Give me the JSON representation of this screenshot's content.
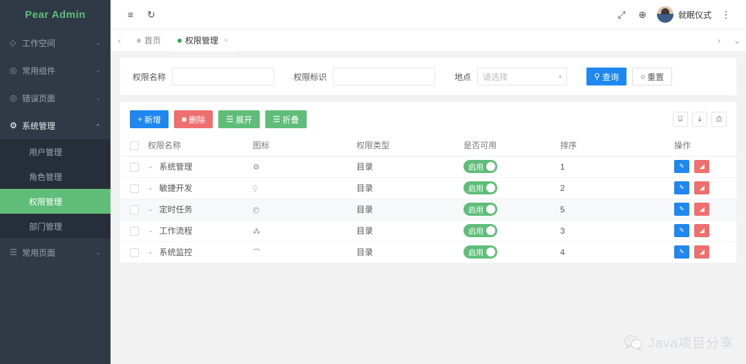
{
  "sidebar": {
    "logo": "Pear Admin",
    "items": [
      {
        "label": "工作空间",
        "icon": "compass-icon",
        "chevron": "⌄",
        "open": false
      },
      {
        "label": "常用组件",
        "icon": "cube-icon",
        "chevron": "⌄",
        "open": false
      },
      {
        "label": "错误页面",
        "icon": "shield-icon",
        "chevron": "⌄",
        "open": false
      },
      {
        "label": "系统管理",
        "icon": "gear-icon",
        "chevron": "⌄",
        "open": true
      },
      {
        "label": "常用页面",
        "icon": "layers-icon",
        "chevron": "⌄",
        "open": false
      }
    ],
    "subitems": [
      {
        "label": "用户管理",
        "active": false
      },
      {
        "label": "角色管理",
        "active": false
      },
      {
        "label": "权限管理",
        "active": true
      },
      {
        "label": "部门管理",
        "active": false
      }
    ],
    "active_color": "#5fbd79",
    "bg_color": "#2f3a46"
  },
  "topbar": {
    "menu_icon": "≡",
    "refresh_icon": "↻",
    "fullscreen_icon": "⤢",
    "language_icon": "⊕",
    "username": "就眠仪式",
    "more_icon": "⋮"
  },
  "tabbar": {
    "prev_icon": "‹",
    "next_icon": "›",
    "dropdown_icon": "⌄",
    "tabs": [
      {
        "label": "首页",
        "active": false,
        "closable": false
      },
      {
        "label": "权限管理",
        "active": true,
        "closable": true,
        "close_icon": "×"
      }
    ]
  },
  "search": {
    "name_label": "权限名称",
    "name_value": "",
    "name_placeholder": "",
    "code_label": "权限标识",
    "code_value": "",
    "code_placeholder": "",
    "place_label": "地点",
    "place_value": "请选择",
    "caret": "▾",
    "query_button": "查询",
    "query_icon": "⚲",
    "reset_button": "重置",
    "reset_icon": "○"
  },
  "toolbar": {
    "add_label": "新增",
    "add_icon": "+",
    "delete_label": "删除",
    "delete_icon": "■",
    "expand_label": "展开",
    "expand_icon": "☰",
    "collapse_label": "折叠",
    "collapse_icon": "☰",
    "tools": [
      {
        "name": "column-filter-icon",
        "glyph": "⌸"
      },
      {
        "name": "export-icon",
        "glyph": "⤓"
      },
      {
        "name": "print-icon",
        "glyph": "⎙"
      }
    ]
  },
  "table": {
    "columns": [
      "权限名称",
      "图标",
      "权限类型",
      "是否可用",
      "排序",
      "操作"
    ],
    "rows": [
      {
        "name": "系统管理",
        "icon_glyph": "⚙",
        "icon_name": "gear-icon",
        "type": "目录",
        "status": "启用",
        "order": "1",
        "hover": false
      },
      {
        "name": "敏捷开发",
        "icon_glyph": "⍜",
        "icon_name": "code-icon",
        "type": "目录",
        "status": "启用",
        "order": "2",
        "hover": false
      },
      {
        "name": "定时任务",
        "icon_glyph": "◴",
        "icon_name": "clock-icon",
        "type": "目录",
        "status": "启用",
        "order": "5",
        "hover": true
      },
      {
        "name": "工作流程",
        "icon_glyph": "⁂",
        "icon_name": "flow-icon",
        "type": "目录",
        "status": "启用",
        "order": "3",
        "hover": false
      },
      {
        "name": "系统监控",
        "icon_glyph": "⌒",
        "icon_name": "dashboard-icon",
        "type": "目录",
        "status": "启用",
        "order": "4",
        "hover": false
      }
    ],
    "tree_chevron": "⌄",
    "edit_icon": "✎",
    "delete_icon": "Ὕ1",
    "status_color": "#5fbd79"
  },
  "watermark": {
    "text": "Java项目分享",
    "icon": "wechat-icon"
  }
}
